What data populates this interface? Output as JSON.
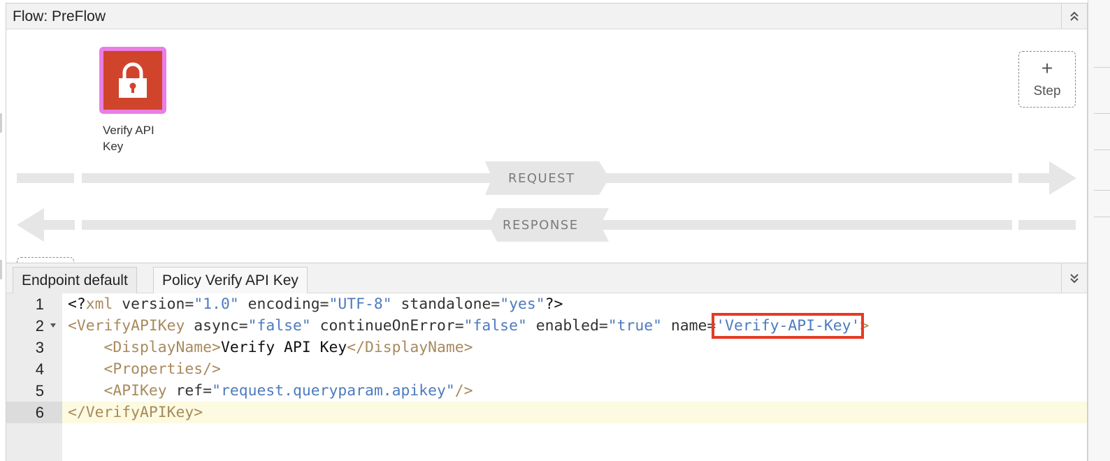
{
  "flow": {
    "title": "Flow: PreFlow"
  },
  "policy": {
    "label": "Verify API Key",
    "icon": "lock-icon",
    "border_color": "#ea7ee6",
    "fill_color": "#d0442c"
  },
  "add_step": {
    "plus": "+",
    "label": "Step"
  },
  "lanes": {
    "request_label": "REQUEST",
    "response_label": "RESPONSE"
  },
  "tabs": [
    {
      "label": "Endpoint default"
    },
    {
      "label": "Policy Verify API Key"
    }
  ],
  "editor": {
    "line_numbers": [
      "1",
      "2",
      "3",
      "4",
      "5",
      "6"
    ],
    "line1": {
      "open": "<?",
      "xml": "xml",
      "a1": " version=",
      "v1": "\"1.0\"",
      "a2": " encoding=",
      "v2": "\"UTF-8\"",
      "a3": " standalone=",
      "v3": "\"yes\"",
      "close": "?>"
    },
    "line2": {
      "tag": "<VerifyAPIKey",
      "a1": " async=",
      "v1": "\"false\"",
      "a2": " continueOnError=",
      "v2": "\"false\"",
      "a3": " enabled=",
      "v3": "\"true\"",
      "a4": " name=",
      "v4": "'Verify-API-Key'",
      "close": ">"
    },
    "line3": {
      "indent": "    ",
      "open_tag": "<DisplayName>",
      "text": "Verify API Key",
      "close_tag": "</DisplayName>"
    },
    "line4": {
      "indent": "    ",
      "tag": "<Properties/>"
    },
    "line5": {
      "indent": "    ",
      "tag": "<APIKey",
      "a1": " ref=",
      "v1": "\"request.queryparam.apikey\"",
      "close": "/>"
    },
    "line6": {
      "tag": "</VerifyAPIKey>"
    },
    "highlight_color": "#e63a25"
  }
}
